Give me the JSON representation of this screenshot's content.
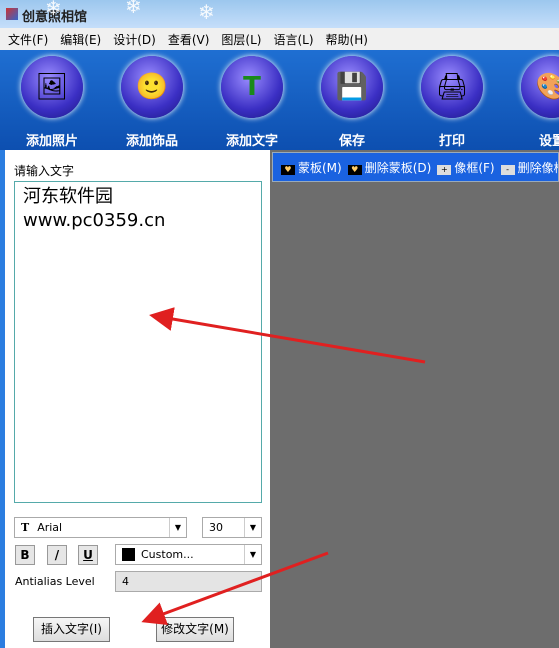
{
  "window": {
    "title": "创意照相馆"
  },
  "watermark": {
    "site": "河东软件园",
    "url": "www.pc0359.cn"
  },
  "menu": [
    "文件(F)",
    "编辑(E)",
    "设计(D)",
    "查看(V)",
    "图层(L)",
    "语言(L)",
    "帮助(H)"
  ],
  "toolbar": [
    {
      "label": "添加照片",
      "icon": "add-photo-icon",
      "glyph": "🖼"
    },
    {
      "label": "添加饰品",
      "icon": "add-decoration-icon",
      "glyph": "🙂"
    },
    {
      "label": "添加文字",
      "icon": "add-text-icon",
      "glyph": "T"
    },
    {
      "label": "保存",
      "icon": "save-icon",
      "glyph": "💾"
    },
    {
      "label": "打印",
      "icon": "print-icon",
      "glyph": "🖨"
    },
    {
      "label": "设置",
      "icon": "settings-icon",
      "glyph": "🎨"
    }
  ],
  "subtoolbar": [
    "蒙板(M)",
    "删除蒙板(D)",
    "像框(F)",
    "删除像框"
  ],
  "text_panel": {
    "prompt": "请输入文字",
    "text": "河东软件园\nwww.pc0359.cn",
    "font": "Arial",
    "size": "30",
    "bold": "B",
    "italic": "/",
    "underline": "U",
    "color": "Custom...",
    "color_hex": "#000000",
    "antialias_label": "Antialias Level",
    "antialias": "4",
    "insert": "插入文字(I)",
    "modify": "修改文字(M)"
  },
  "annotation_color": "#e02020"
}
